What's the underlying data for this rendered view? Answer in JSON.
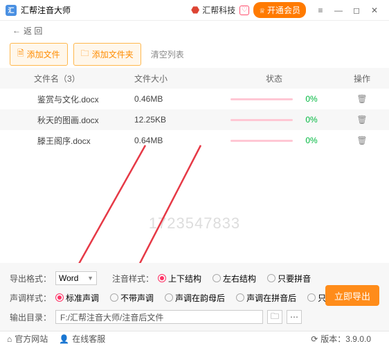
{
  "app": {
    "title": "汇帮注音大师",
    "tech": "汇帮科技",
    "vip": "开通会员"
  },
  "back": "返 回",
  "toolbar": {
    "addFile": "添加文件",
    "addFolder": "添加文件夹",
    "clear": "清空列表"
  },
  "headers": {
    "name": "文件名（3）",
    "size": "文件大小",
    "status": "状态",
    "op": "操作"
  },
  "rows": [
    {
      "name": "鉴赏与文化.docx",
      "size": "0.46MB",
      "pct": "0%"
    },
    {
      "name": "秋天的图画.docx",
      "size": "12.25KB",
      "pct": "0%"
    },
    {
      "name": "滕王阁序.docx",
      "size": "0.64MB",
      "pct": "0%"
    }
  ],
  "watermark": "1723547833",
  "labels": {
    "exportFmt": "导出格式：",
    "fmtVal": "Word",
    "zhuyinFmt": "注音样式：",
    "toneFmt": "声调样式：",
    "outDir": "输出目录：",
    "export": "立即导出"
  },
  "zhuyin": {
    "o1": "上下结构",
    "o2": "左右结构",
    "o3": "只要拼音"
  },
  "tone": {
    "o1": "标准声调",
    "o2": "不带声调",
    "o3": "声调在韵母后",
    "o4": "声调在拼音后",
    "o5": "只要声调"
  },
  "outPath": "F:/汇帮注音大师/注音后文件",
  "footer": {
    "site": "官方网站",
    "service": "在线客服",
    "version": "版本：3.9.0.0"
  }
}
